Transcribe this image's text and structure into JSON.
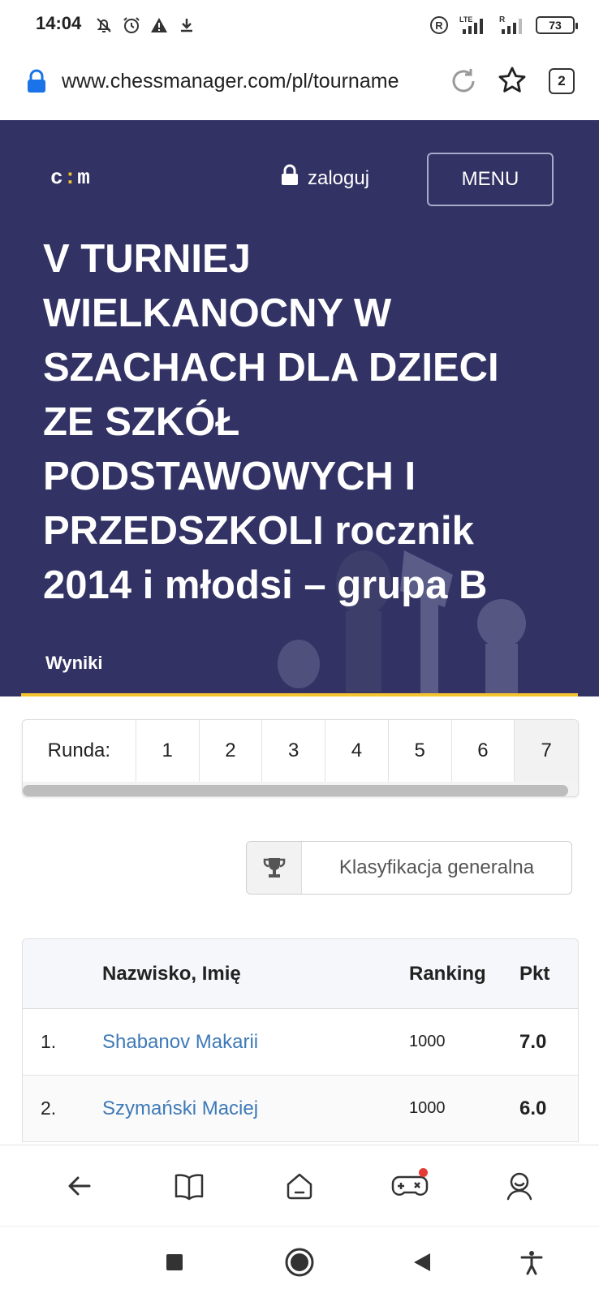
{
  "status_bar": {
    "time": "14:04",
    "battery": "73",
    "signal_lte": "LTE",
    "signal_r": "R"
  },
  "browser": {
    "url": "www.chessmanager.com/pl/tourname",
    "tab_count": "2"
  },
  "header": {
    "logo_left": "c",
    "logo_dot": ":",
    "logo_right": "m",
    "login_label": "zaloguj",
    "menu_label": "MENU"
  },
  "tournament": {
    "title_line1": "V TURNIEJ",
    "title_line2": "WIELKANOCNY W",
    "title_line3": "SZACHACH DLA DZIECI",
    "title_line4": "ZE SZKÓŁ",
    "title_line5": "PODSTAWOWYCH I",
    "title_line6_upper": "PRZEDSZKOLI",
    "title_line6_lower": " rocznik",
    "title_line7": "2014 i młodsi – grupa B",
    "tab_results": "Wyniki"
  },
  "rounds": {
    "label": "Runda:",
    "items": [
      "1",
      "2",
      "3",
      "4",
      "5",
      "6",
      "7"
    ],
    "active": "7"
  },
  "classification": {
    "label": "Klasyfikacja generalna"
  },
  "results_table": {
    "headers": {
      "name": "Nazwisko, Imię",
      "ranking": "Ranking",
      "points": "Pkt"
    },
    "rows": [
      {
        "pos": "1.",
        "name": "Shabanov Makarii",
        "ranking": "1000",
        "points": "7.0"
      },
      {
        "pos": "2.",
        "name": "Szymański Maciej",
        "ranking": "1000",
        "points": "6.0"
      }
    ]
  },
  "colors": {
    "hero_bg": "#323264",
    "accent_yellow": "#f4c430",
    "link_blue": "#3e7ab8",
    "lock_blue": "#1a73e8"
  }
}
